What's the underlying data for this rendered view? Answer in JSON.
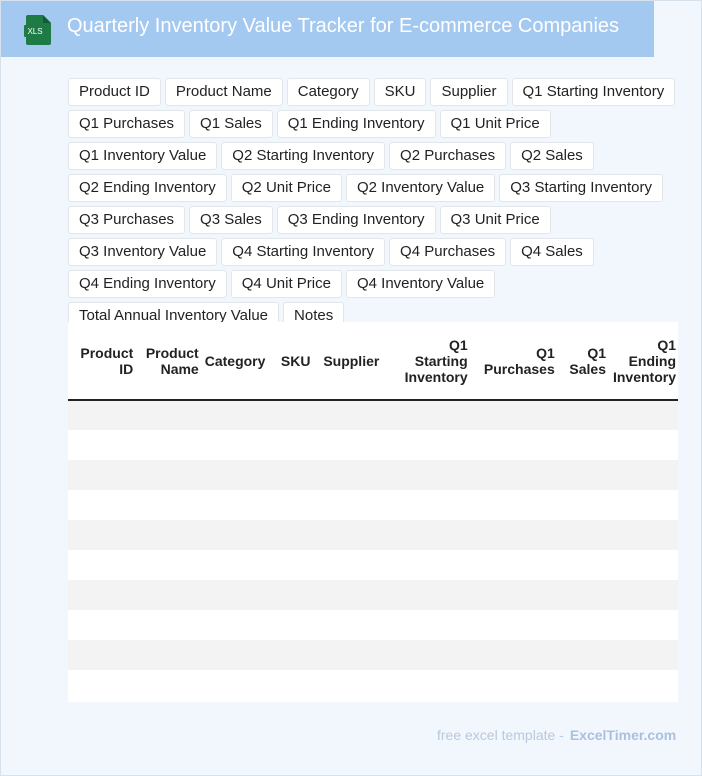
{
  "header": {
    "title": "Quarterly Inventory Value Tracker for E-commerce Companies",
    "icon_label": "XLS",
    "icon": "excel-file-icon"
  },
  "columns": [
    "Product ID",
    "Product Name",
    "Category",
    "SKU",
    "Supplier",
    "Q1 Starting Inventory",
    "Q1 Purchases",
    "Q1 Sales",
    "Q1 Ending Inventory",
    "Q1 Unit Price",
    "Q1 Inventory Value",
    "Q2 Starting Inventory",
    "Q2 Purchases",
    "Q2 Sales",
    "Q2 Ending Inventory",
    "Q2 Unit Price",
    "Q2 Inventory Value",
    "Q3 Starting Inventory",
    "Q3 Purchases",
    "Q3 Sales",
    "Q3 Ending Inventory",
    "Q3 Unit Price",
    "Q3 Inventory Value",
    "Q4 Starting Inventory",
    "Q4 Purchases",
    "Q4 Sales",
    "Q4 Ending Inventory",
    "Q4 Unit Price",
    "Q4 Inventory Value",
    "Total Annual Inventory Value",
    "Notes"
  ],
  "table": {
    "headers": [
      "Product ID",
      "Product Name",
      "Category",
      "SKU",
      "Supplier",
      "Q1 Starting Inventory",
      "Q1 Purchases",
      "Q1 Sales",
      "Q1 Ending Inventory"
    ],
    "rows": [
      [],
      [],
      [],
      [],
      [],
      [],
      [],
      [],
      [],
      []
    ]
  },
  "footer": {
    "text": "free excel template -",
    "brand": "ExcelTimer.com"
  },
  "colors": {
    "header_bg": "#a4c9f1",
    "page_bg": "#f2f7fd",
    "icon_green": "#1e7b45"
  }
}
